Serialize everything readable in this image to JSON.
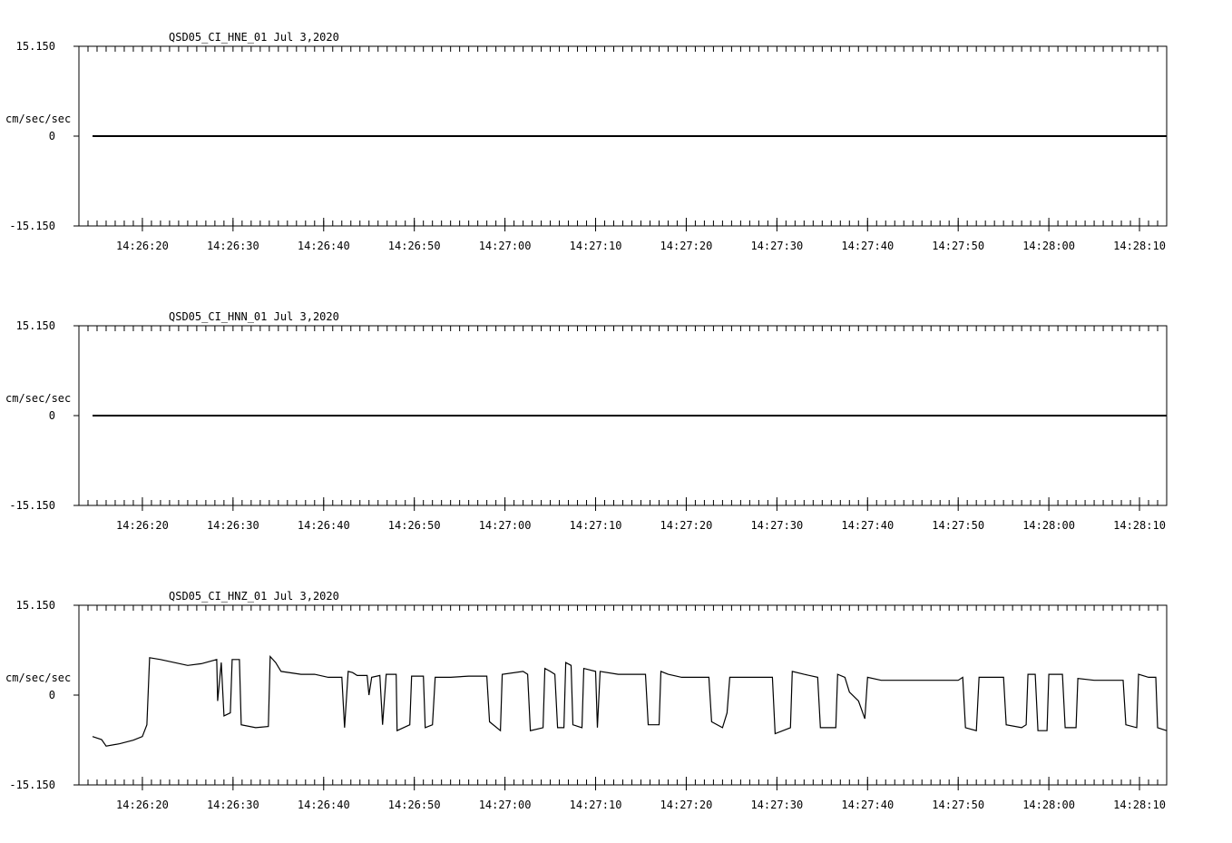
{
  "chart_data": [
    {
      "type": "line",
      "title": "QSD05_CI_HNE_01  Jul 3,2020",
      "ylabel": "cm/sec/sec",
      "ylim": [
        -15.15,
        15.15
      ],
      "y_ticks": [
        "15.150",
        "0",
        "-15.150"
      ],
      "x_ticks": [
        "14:26:20",
        "14:26:30",
        "14:26:40",
        "14:26:50",
        "14:27:00",
        "14:27:10",
        "14:27:20",
        "14:27:30",
        "14:27:40",
        "14:27:50",
        "14:28:00",
        "14:28:10"
      ],
      "x_start": "14:26:13",
      "x_end": "14:28:13",
      "trace_start": "14:26:14.5",
      "series": [
        {
          "points": [
            [
              0,
              0.0
            ],
            [
              118.5,
              0.0
            ]
          ]
        }
      ]
    },
    {
      "type": "line",
      "title": "QSD05_CI_HNN_01  Jul 3,2020",
      "ylabel": "cm/sec/sec",
      "ylim": [
        -15.15,
        15.15
      ],
      "y_ticks": [
        "15.150",
        "0",
        "-15.150"
      ],
      "x_ticks": [
        "14:26:20",
        "14:26:30",
        "14:26:40",
        "14:26:50",
        "14:27:00",
        "14:27:10",
        "14:27:20",
        "14:27:30",
        "14:27:40",
        "14:27:50",
        "14:28:00",
        "14:28:10"
      ],
      "x_start": "14:26:13",
      "x_end": "14:28:13",
      "trace_start": "14:26:14.5",
      "series": [
        {
          "points": [
            [
              0,
              0.0
            ],
            [
              118.5,
              0.0
            ]
          ]
        }
      ]
    },
    {
      "type": "line",
      "title": "QSD05_CI_HNZ_01  Jul 3,2020",
      "ylabel": "cm/sec/sec",
      "ylim": [
        -15.15,
        15.15
      ],
      "y_ticks": [
        "15.150",
        "0",
        "-15.150"
      ],
      "x_ticks": [
        "14:26:20",
        "14:26:30",
        "14:26:40",
        "14:26:50",
        "14:27:00",
        "14:27:10",
        "14:27:20",
        "14:27:30",
        "14:27:40",
        "14:27:50",
        "14:28:00",
        "14:28:10"
      ],
      "x_start": "14:26:13",
      "x_end": "14:28:13",
      "trace_start": "14:26:14.5",
      "series": [
        {
          "points": [
            [
              0,
              -7.0
            ],
            [
              1.0,
              -7.5
            ],
            [
              1.5,
              -8.6
            ],
            [
              3,
              -8.2
            ],
            [
              4.5,
              -7.6
            ],
            [
              5.5,
              -7.0
            ],
            [
              6.0,
              -5.0
            ],
            [
              6.3,
              6.3
            ],
            [
              7.5,
              6.0
            ],
            [
              9,
              5.5
            ],
            [
              10.5,
              5.0
            ],
            [
              12,
              5.3
            ],
            [
              13.7,
              6.0
            ],
            [
              13.8,
              -1.0
            ],
            [
              14.2,
              5.5
            ],
            [
              14.5,
              -3.5
            ],
            [
              15.2,
              -3.0
            ],
            [
              15.4,
              6.0
            ],
            [
              16.2,
              6.0
            ],
            [
              16.4,
              -5.0
            ],
            [
              18,
              -5.5
            ],
            [
              19.4,
              -5.3
            ],
            [
              19.6,
              6.5
            ],
            [
              20.2,
              5.5
            ],
            [
              20.8,
              4.0
            ],
            [
              23,
              3.5
            ],
            [
              24.5,
              3.5
            ],
            [
              26,
              3.0
            ],
            [
              27.5,
              3.0
            ],
            [
              27.8,
              -5.5
            ],
            [
              28.2,
              4.0
            ],
            [
              28.7,
              3.8
            ],
            [
              29.2,
              3.3
            ],
            [
              30.3,
              3.3
            ],
            [
              30.5,
              0.0
            ],
            [
              30.8,
              3.0
            ],
            [
              31.7,
              3.3
            ],
            [
              32.0,
              -5.0
            ],
            [
              32.4,
              3.5
            ],
            [
              33.5,
              3.5
            ],
            [
              33.6,
              -6.0
            ],
            [
              35.0,
              -5.0
            ],
            [
              35.2,
              3.2
            ],
            [
              36.5,
              3.2
            ],
            [
              36.7,
              -5.5
            ],
            [
              37.5,
              -5.0
            ],
            [
              37.8,
              3.0
            ],
            [
              39.5,
              3.0
            ],
            [
              41.5,
              3.2
            ],
            [
              43.5,
              3.2
            ],
            [
              43.8,
              -4.5
            ],
            [
              45.0,
              -6.0
            ],
            [
              45.2,
              3.5
            ],
            [
              47.5,
              4.0
            ],
            [
              48.0,
              3.5
            ],
            [
              48.3,
              -6.0
            ],
            [
              49.7,
              -5.5
            ],
            [
              49.9,
              4.5
            ],
            [
              50.5,
              4.0
            ],
            [
              51.0,
              3.5
            ],
            [
              51.3,
              -5.5
            ],
            [
              52.0,
              -5.5
            ],
            [
              52.2,
              5.5
            ],
            [
              52.8,
              5.0
            ],
            [
              53.0,
              -5.0
            ],
            [
              54.0,
              -5.5
            ],
            [
              54.2,
              4.5
            ],
            [
              55.5,
              4.0
            ],
            [
              55.7,
              -5.5
            ],
            [
              56.0,
              4.0
            ],
            [
              58.0,
              3.5
            ],
            [
              60.0,
              3.5
            ],
            [
              61.0,
              3.5
            ],
            [
              61.3,
              -5.0
            ],
            [
              62.5,
              -5.0
            ],
            [
              62.7,
              4.0
            ],
            [
              63.5,
              3.5
            ],
            [
              65.0,
              3.0
            ],
            [
              67.0,
              3.0
            ],
            [
              68.0,
              3.0
            ],
            [
              68.3,
              -4.5
            ],
            [
              69.5,
              -5.5
            ],
            [
              70.0,
              -3.0
            ],
            [
              70.3,
              3.0
            ],
            [
              72.0,
              3.0
            ],
            [
              74.0,
              3.0
            ],
            [
              75.0,
              3.0
            ],
            [
              75.3,
              -6.5
            ],
            [
              77.0,
              -5.5
            ],
            [
              77.2,
              4.0
            ],
            [
              78.5,
              3.5
            ],
            [
              80.0,
              3.0
            ],
            [
              80.3,
              -5.5
            ],
            [
              82.0,
              -5.5
            ],
            [
              82.2,
              3.5
            ],
            [
              83.0,
              3.0
            ],
            [
              83.5,
              0.5
            ],
            [
              84.5,
              -1.0
            ],
            [
              85.2,
              -4.0
            ],
            [
              85.5,
              3.0
            ],
            [
              87.0,
              2.5
            ],
            [
              89.0,
              2.5
            ],
            [
              91.0,
              2.5
            ],
            [
              93.0,
              2.5
            ],
            [
              95.5,
              2.5
            ],
            [
              96.0,
              3.0
            ],
            [
              96.3,
              -5.5
            ],
            [
              97.5,
              -6.0
            ],
            [
              97.8,
              3.0
            ],
            [
              99.0,
              3.0
            ],
            [
              100.5,
              3.0
            ],
            [
              100.8,
              -5.0
            ],
            [
              102.5,
              -5.5
            ],
            [
              103.0,
              -5.0
            ],
            [
              103.2,
              3.5
            ],
            [
              104.0,
              3.5
            ],
            [
              104.3,
              -6.0
            ],
            [
              105.3,
              -6.0
            ],
            [
              105.5,
              3.5
            ],
            [
              107.0,
              3.5
            ],
            [
              107.3,
              -5.5
            ],
            [
              108.5,
              -5.5
            ],
            [
              108.7,
              2.8
            ],
            [
              110.5,
              2.5
            ],
            [
              112.5,
              2.5
            ],
            [
              113.7,
              2.5
            ],
            [
              114.0,
              -5.0
            ],
            [
              115.2,
              -5.5
            ],
            [
              115.4,
              3.5
            ],
            [
              116.5,
              3.0
            ],
            [
              117.3,
              3.0
            ],
            [
              117.5,
              -5.5
            ],
            [
              118.5,
              -6.0
            ]
          ]
        }
      ]
    }
  ]
}
